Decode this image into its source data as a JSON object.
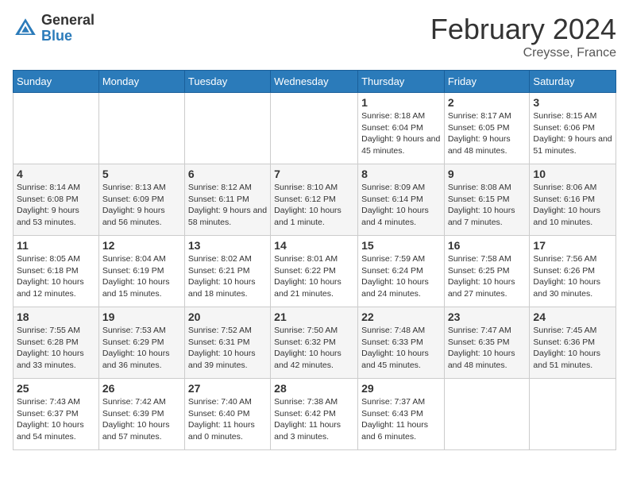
{
  "header": {
    "logo_general": "General",
    "logo_blue": "Blue",
    "month_title": "February 2024",
    "location": "Creysse, France"
  },
  "days_of_week": [
    "Sunday",
    "Monday",
    "Tuesday",
    "Wednesday",
    "Thursday",
    "Friday",
    "Saturday"
  ],
  "weeks": [
    {
      "days": [
        {
          "num": "",
          "info": ""
        },
        {
          "num": "",
          "info": ""
        },
        {
          "num": "",
          "info": ""
        },
        {
          "num": "",
          "info": ""
        },
        {
          "num": "1",
          "info": "Sunrise: 8:18 AM\nSunset: 6:04 PM\nDaylight: 9 hours and 45 minutes."
        },
        {
          "num": "2",
          "info": "Sunrise: 8:17 AM\nSunset: 6:05 PM\nDaylight: 9 hours and 48 minutes."
        },
        {
          "num": "3",
          "info": "Sunrise: 8:15 AM\nSunset: 6:06 PM\nDaylight: 9 hours and 51 minutes."
        }
      ]
    },
    {
      "days": [
        {
          "num": "4",
          "info": "Sunrise: 8:14 AM\nSunset: 6:08 PM\nDaylight: 9 hours and 53 minutes."
        },
        {
          "num": "5",
          "info": "Sunrise: 8:13 AM\nSunset: 6:09 PM\nDaylight: 9 hours and 56 minutes."
        },
        {
          "num": "6",
          "info": "Sunrise: 8:12 AM\nSunset: 6:11 PM\nDaylight: 9 hours and 58 minutes."
        },
        {
          "num": "7",
          "info": "Sunrise: 8:10 AM\nSunset: 6:12 PM\nDaylight: 10 hours and 1 minute."
        },
        {
          "num": "8",
          "info": "Sunrise: 8:09 AM\nSunset: 6:14 PM\nDaylight: 10 hours and 4 minutes."
        },
        {
          "num": "9",
          "info": "Sunrise: 8:08 AM\nSunset: 6:15 PM\nDaylight: 10 hours and 7 minutes."
        },
        {
          "num": "10",
          "info": "Sunrise: 8:06 AM\nSunset: 6:16 PM\nDaylight: 10 hours and 10 minutes."
        }
      ]
    },
    {
      "days": [
        {
          "num": "11",
          "info": "Sunrise: 8:05 AM\nSunset: 6:18 PM\nDaylight: 10 hours and 12 minutes."
        },
        {
          "num": "12",
          "info": "Sunrise: 8:04 AM\nSunset: 6:19 PM\nDaylight: 10 hours and 15 minutes."
        },
        {
          "num": "13",
          "info": "Sunrise: 8:02 AM\nSunset: 6:21 PM\nDaylight: 10 hours and 18 minutes."
        },
        {
          "num": "14",
          "info": "Sunrise: 8:01 AM\nSunset: 6:22 PM\nDaylight: 10 hours and 21 minutes."
        },
        {
          "num": "15",
          "info": "Sunrise: 7:59 AM\nSunset: 6:24 PM\nDaylight: 10 hours and 24 minutes."
        },
        {
          "num": "16",
          "info": "Sunrise: 7:58 AM\nSunset: 6:25 PM\nDaylight: 10 hours and 27 minutes."
        },
        {
          "num": "17",
          "info": "Sunrise: 7:56 AM\nSunset: 6:26 PM\nDaylight: 10 hours and 30 minutes."
        }
      ]
    },
    {
      "days": [
        {
          "num": "18",
          "info": "Sunrise: 7:55 AM\nSunset: 6:28 PM\nDaylight: 10 hours and 33 minutes."
        },
        {
          "num": "19",
          "info": "Sunrise: 7:53 AM\nSunset: 6:29 PM\nDaylight: 10 hours and 36 minutes."
        },
        {
          "num": "20",
          "info": "Sunrise: 7:52 AM\nSunset: 6:31 PM\nDaylight: 10 hours and 39 minutes."
        },
        {
          "num": "21",
          "info": "Sunrise: 7:50 AM\nSunset: 6:32 PM\nDaylight: 10 hours and 42 minutes."
        },
        {
          "num": "22",
          "info": "Sunrise: 7:48 AM\nSunset: 6:33 PM\nDaylight: 10 hours and 45 minutes."
        },
        {
          "num": "23",
          "info": "Sunrise: 7:47 AM\nSunset: 6:35 PM\nDaylight: 10 hours and 48 minutes."
        },
        {
          "num": "24",
          "info": "Sunrise: 7:45 AM\nSunset: 6:36 PM\nDaylight: 10 hours and 51 minutes."
        }
      ]
    },
    {
      "days": [
        {
          "num": "25",
          "info": "Sunrise: 7:43 AM\nSunset: 6:37 PM\nDaylight: 10 hours and 54 minutes."
        },
        {
          "num": "26",
          "info": "Sunrise: 7:42 AM\nSunset: 6:39 PM\nDaylight: 10 hours and 57 minutes."
        },
        {
          "num": "27",
          "info": "Sunrise: 7:40 AM\nSunset: 6:40 PM\nDaylight: 11 hours and 0 minutes."
        },
        {
          "num": "28",
          "info": "Sunrise: 7:38 AM\nSunset: 6:42 PM\nDaylight: 11 hours and 3 minutes."
        },
        {
          "num": "29",
          "info": "Sunrise: 7:37 AM\nSunset: 6:43 PM\nDaylight: 11 hours and 6 minutes."
        },
        {
          "num": "",
          "info": ""
        },
        {
          "num": "",
          "info": ""
        }
      ]
    }
  ]
}
